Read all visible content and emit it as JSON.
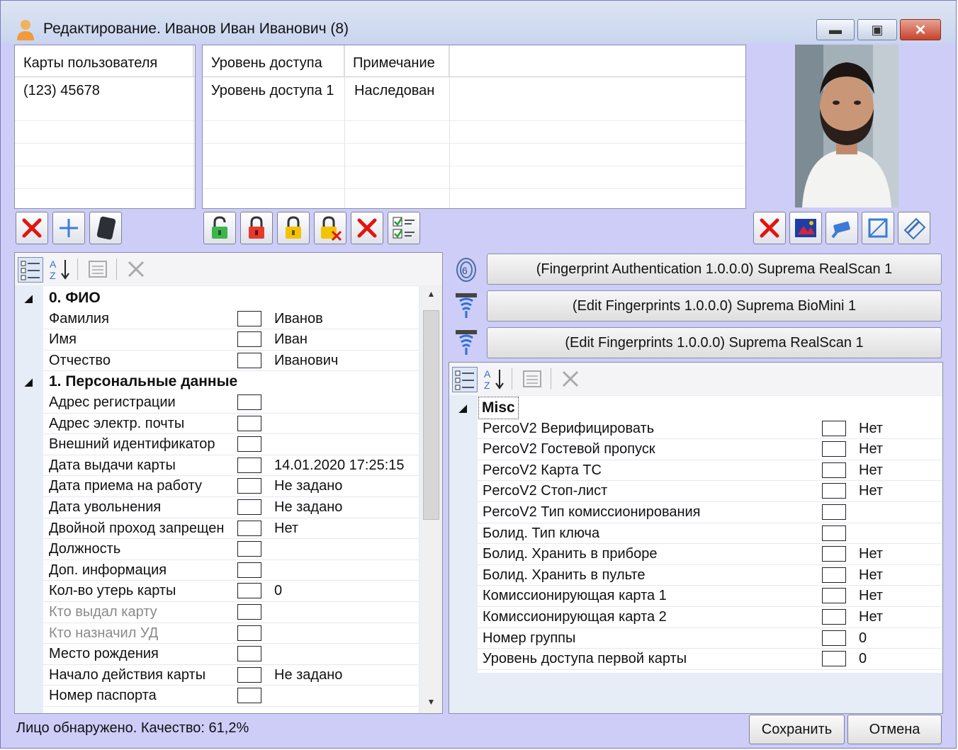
{
  "window": {
    "title": "Редактирование. Иванов Иван Иванович (8)",
    "buttons": [
      "minimize",
      "maximize",
      "close"
    ]
  },
  "cards_grid": {
    "header": "Карты пользователя",
    "rows": [
      "(123) 45678"
    ]
  },
  "access_grid": {
    "headers": [
      "Уровень доступа",
      "Примечание"
    ],
    "rows": [
      [
        "Уровень доступа 1",
        "Наследован"
      ]
    ]
  },
  "card_toolbar": [
    "delete-icon",
    "add-icon",
    "card-reader-icon"
  ],
  "access_toolbar": [
    "lock-open-green-icon",
    "lock-red-icon",
    "lock-yellow-icon",
    "lock-remove-icon",
    "delete-icon",
    "checklist-icon"
  ],
  "photo_toolbar": [
    "delete-icon",
    "photo-icon",
    "camera-icon",
    "crop-icon",
    "scanner-icon"
  ],
  "left_props": {
    "categories": [
      {
        "name": "0. ФИО",
        "items": [
          {
            "name": "Фамилия",
            "value": "Иванов"
          },
          {
            "name": "Имя",
            "value": "Иван"
          },
          {
            "name": "Отчество",
            "value": "Иванович"
          }
        ]
      },
      {
        "name": "1. Персональные данные",
        "items": [
          {
            "name": "Адрес регистрации",
            "value": ""
          },
          {
            "name": "Адрес электр. почты",
            "value": ""
          },
          {
            "name": "Внешний идентификатор",
            "value": ""
          },
          {
            "name": "Дата выдачи карты",
            "value": "14.01.2020 17:25:15"
          },
          {
            "name": "Дата приема на работу",
            "value": "Не задано"
          },
          {
            "name": "Дата увольнения",
            "value": "Не задано"
          },
          {
            "name": "Двойной проход запрещен",
            "value": "Нет"
          },
          {
            "name": "Должность",
            "value": ""
          },
          {
            "name": "Доп. информация",
            "value": ""
          },
          {
            "name": "Кол-во утерь карты",
            "value": "0"
          },
          {
            "name": "Кто выдал карту",
            "value": "",
            "disabled": true
          },
          {
            "name": "Кто назначил УД",
            "value": "",
            "disabled": true
          },
          {
            "name": "Место рождения",
            "value": ""
          },
          {
            "name": "Начало действия карты",
            "value": "Не задано"
          },
          {
            "name": "Номер паспорта",
            "value": ""
          }
        ]
      }
    ]
  },
  "fingerprint_buttons": [
    "(Fingerprint Authentication 1.0.0.0) Suprema RealScan 1",
    "(Edit Fingerprints 1.0.0.0) Suprema BioMini 1",
    "(Edit Fingerprints 1.0.0.0) Suprema RealScan 1"
  ],
  "right_props": {
    "category": "Misc",
    "items": [
      {
        "name": "PercoV2 Верифицировать",
        "value": "Нет"
      },
      {
        "name": "PercoV2 Гостевой пропуск",
        "value": "Нет"
      },
      {
        "name": "PercoV2 Карта ТС",
        "value": "Нет"
      },
      {
        "name": "PercoV2 Стоп-лист",
        "value": "Нет"
      },
      {
        "name": "PercoV2 Тип комиссионирования",
        "value": ""
      },
      {
        "name": "Болид. Тип ключа",
        "value": ""
      },
      {
        "name": "Болид. Хранить в приборе",
        "value": "Нет"
      },
      {
        "name": "Болид. Хранить в пульте",
        "value": "Нет"
      },
      {
        "name": "Комиссионирующая карта 1",
        "value": "Нет"
      },
      {
        "name": "Комиссионирующая карта 2",
        "value": "Нет"
      },
      {
        "name": "Номер группы",
        "value": "0"
      },
      {
        "name": "Уровень доступа первой карты",
        "value": "0"
      }
    ]
  },
  "status": "Лицо обнаружено. Качество: 61,2%",
  "buttons": {
    "save": "Сохранить",
    "cancel": "Отмена"
  }
}
